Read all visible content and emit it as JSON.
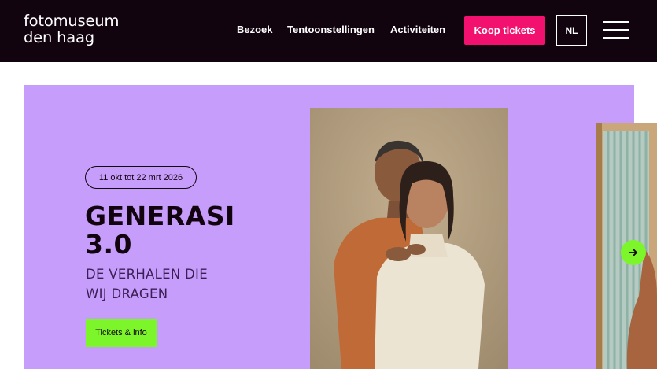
{
  "header": {
    "logo_line1": "fotomuseum",
    "logo_line2": "den haag",
    "nav": [
      "Bezoek",
      "Tentoonstellingen",
      "Activiteiten"
    ],
    "tickets_label": "Koop tickets",
    "language": "NL",
    "menu_icon": "hamburger-icon"
  },
  "hero": {
    "date": "11 okt tot 22 mrt 2026",
    "title_line1": "GENERASI",
    "title_line2": "3.0",
    "subtitle_line1": "DE VERHALEN DIE",
    "subtitle_line2": "WIJ DRAGEN",
    "cta_label": "Tickets & info",
    "next_icon": "arrow-right-icon"
  },
  "colors": {
    "header_bg": "#12040f",
    "accent_pink": "#f3116f",
    "hero_bg": "#c79dfb",
    "accent_green": "#7cf52a"
  }
}
